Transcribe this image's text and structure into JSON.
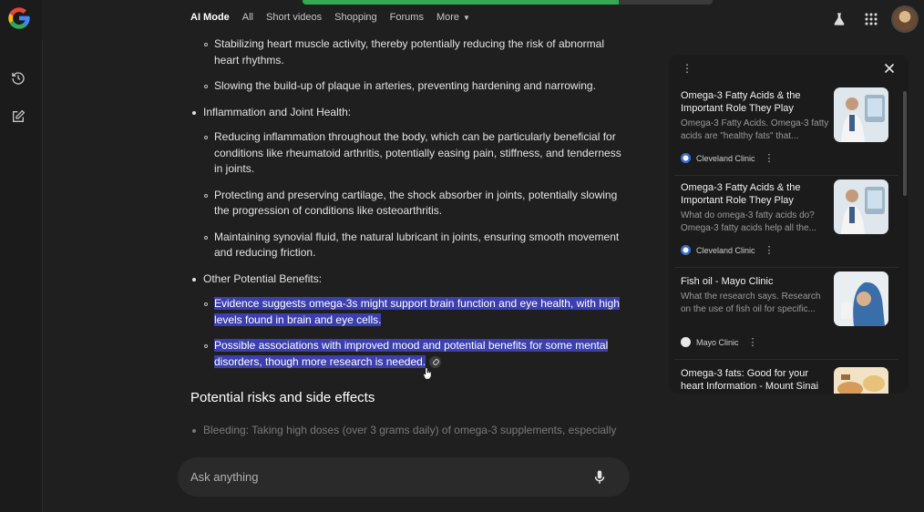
{
  "nav": {
    "tabs": [
      {
        "label": "AI Mode",
        "active": true
      },
      {
        "label": "All"
      },
      {
        "label": "Short videos"
      },
      {
        "label": "Shopping"
      },
      {
        "label": "Forums"
      },
      {
        "label": "More"
      }
    ],
    "progress_fraction": 0.77
  },
  "icons": {
    "history": "history-icon",
    "new_chat": "edit-icon",
    "labs": "flask-icon",
    "apps": "apps-grid-icon",
    "mic": "mic-icon"
  },
  "answer": {
    "cardio_items": [
      "Stabilizing heart muscle activity, thereby potentially reducing the risk of abnormal heart rhythms.",
      "Slowing the build-up of plaque in arteries, preventing hardening and narrowing."
    ],
    "inflammation_heading": "Inflammation and Joint Health:",
    "inflammation_items": [
      "Reducing inflammation throughout the body, which can be particularly beneficial for conditions like rheumatoid arthritis, potentially easing pain, stiffness, and tenderness in joints.",
      "Protecting and preserving cartilage, the shock absorber in joints, potentially slowing the progression of conditions like osteoarthritis.",
      "Maintaining synovial fluid, the natural lubricant in joints, ensuring smooth movement and reducing friction."
    ],
    "other_heading": "Other Potential Benefits:",
    "other_items": [
      "Evidence suggests omega-3s might support brain function and eye health, with high levels found in brain and eye cells.",
      "Possible associations with improved mood and potential benefits for some mental disorders, though more research is needed."
    ],
    "risks_heading": "Potential risks and side effects",
    "risks_first_item_label": "Bleeding:",
    "risks_first_item_text": " Taking high doses (over 3 grams daily) of omega-3 supplements, especially"
  },
  "ask": {
    "placeholder": "Ask anything"
  },
  "sources": [
    {
      "title": "Omega-3 Fatty Acids & the Important Role They Play",
      "snippet": "Omega-3 Fatty Acids. Omega-3 fatty acids are \"healthy fats\" that...",
      "site": "Cleveland Clinic",
      "favicon_color": "#3b6fd1"
    },
    {
      "title": "Omega-3 Fatty Acids & the Important Role They Play",
      "snippet": "What do omega-3 fatty acids do? Omega-3 fatty acids help all the...",
      "site": "Cleveland Clinic",
      "favicon_color": "#3b6fd1"
    },
    {
      "title": "Fish oil - Mayo Clinic",
      "snippet": "What the research says. Research on the use of fish oil for specific...",
      "site": "Mayo Clinic",
      "favicon_color": "#e8e8e8"
    },
    {
      "title": "Omega-3 fats: Good for your heart Information - Mount Sinai",
      "snippet": "",
      "site": "",
      "favicon_color": ""
    }
  ]
}
